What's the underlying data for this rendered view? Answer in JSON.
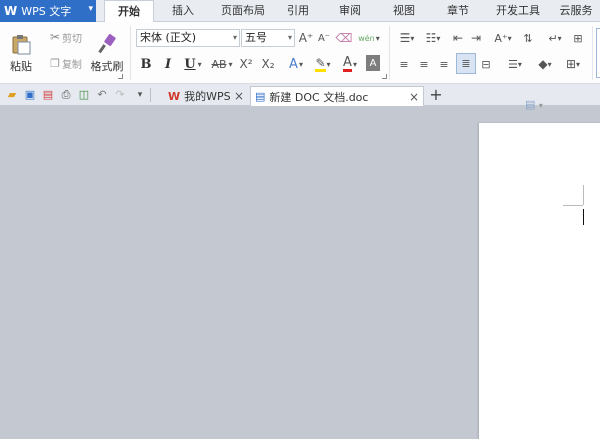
{
  "app": {
    "logo": "W",
    "title": "WPS 文字",
    "menu_arrow": "▾"
  },
  "menu": {
    "tabs": [
      {
        "label": "开始",
        "active": true
      },
      {
        "label": "插入"
      },
      {
        "label": "页面布局"
      },
      {
        "label": "引用"
      },
      {
        "label": "审阅"
      },
      {
        "label": "视图"
      },
      {
        "label": "章节"
      },
      {
        "label": "开发工具"
      },
      {
        "label": "云服务"
      }
    ]
  },
  "ribbon": {
    "paste_label": "粘贴",
    "cut_label": "剪切",
    "copy_label": "复制",
    "format_painter_label": "格式刷",
    "font_name": "宋体 (正文)",
    "font_size": "五号",
    "bold": "B",
    "italic": "I",
    "underline": "U",
    "strikethrough": "AB",
    "superscript": "X²",
    "subscript": "X₂",
    "grow_font": "A⁺",
    "shrink_font": "A⁻",
    "phonetic": "wén",
    "font_color_letter": "A",
    "highlight_color": "#ffe000",
    "font_color": "#e02020",
    "accent_color": "#2f6fc8"
  },
  "tabbar": {
    "home_tab_label": "我的WPS",
    "doc_tab_label": "新建 DOC 文档.doc",
    "close_glyph": "×",
    "new_tab_glyph": "+"
  }
}
